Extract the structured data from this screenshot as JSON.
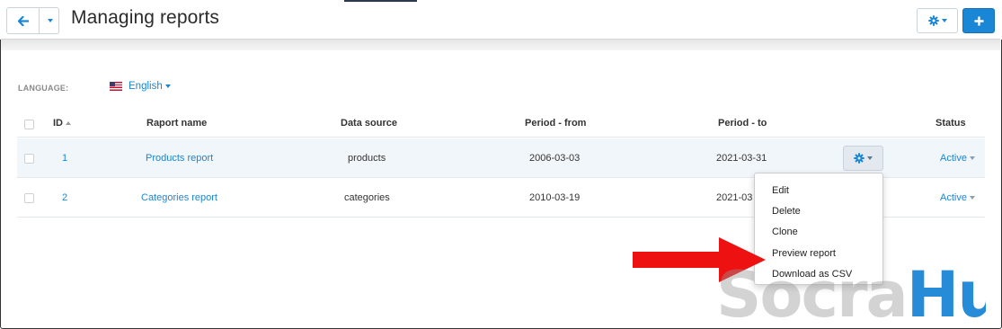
{
  "header": {
    "title": "Managing reports",
    "back_icon": "arrow-left-icon",
    "settings_icon": "gear-icon",
    "add_icon": "plus-icon"
  },
  "language": {
    "label": "LANGUAGE:",
    "value": "English",
    "flag_icon": "us-flag-icon"
  },
  "table": {
    "columns": [
      "ID",
      "Raport name",
      "Data source",
      "Period - from",
      "Period - to",
      "Status"
    ],
    "rows": [
      {
        "id": "1",
        "name": "Products report",
        "source": "products",
        "from": "2006-03-03",
        "to": "2021-03-31",
        "status": "Active"
      },
      {
        "id": "2",
        "name": "Categories report",
        "source": "categories",
        "from": "2010-03-19",
        "to": "2021-03",
        "status": "Active"
      }
    ]
  },
  "actions_menu": {
    "items": [
      "Edit",
      "Delete",
      "Clone",
      "Preview report",
      "Download as CSV"
    ]
  },
  "watermark": {
    "part1": "Socra",
    "part2": "Hub"
  },
  "colors": {
    "accent": "#1a86d6",
    "arrow": "#ee1111",
    "row_hover": "#f1f6fa"
  }
}
